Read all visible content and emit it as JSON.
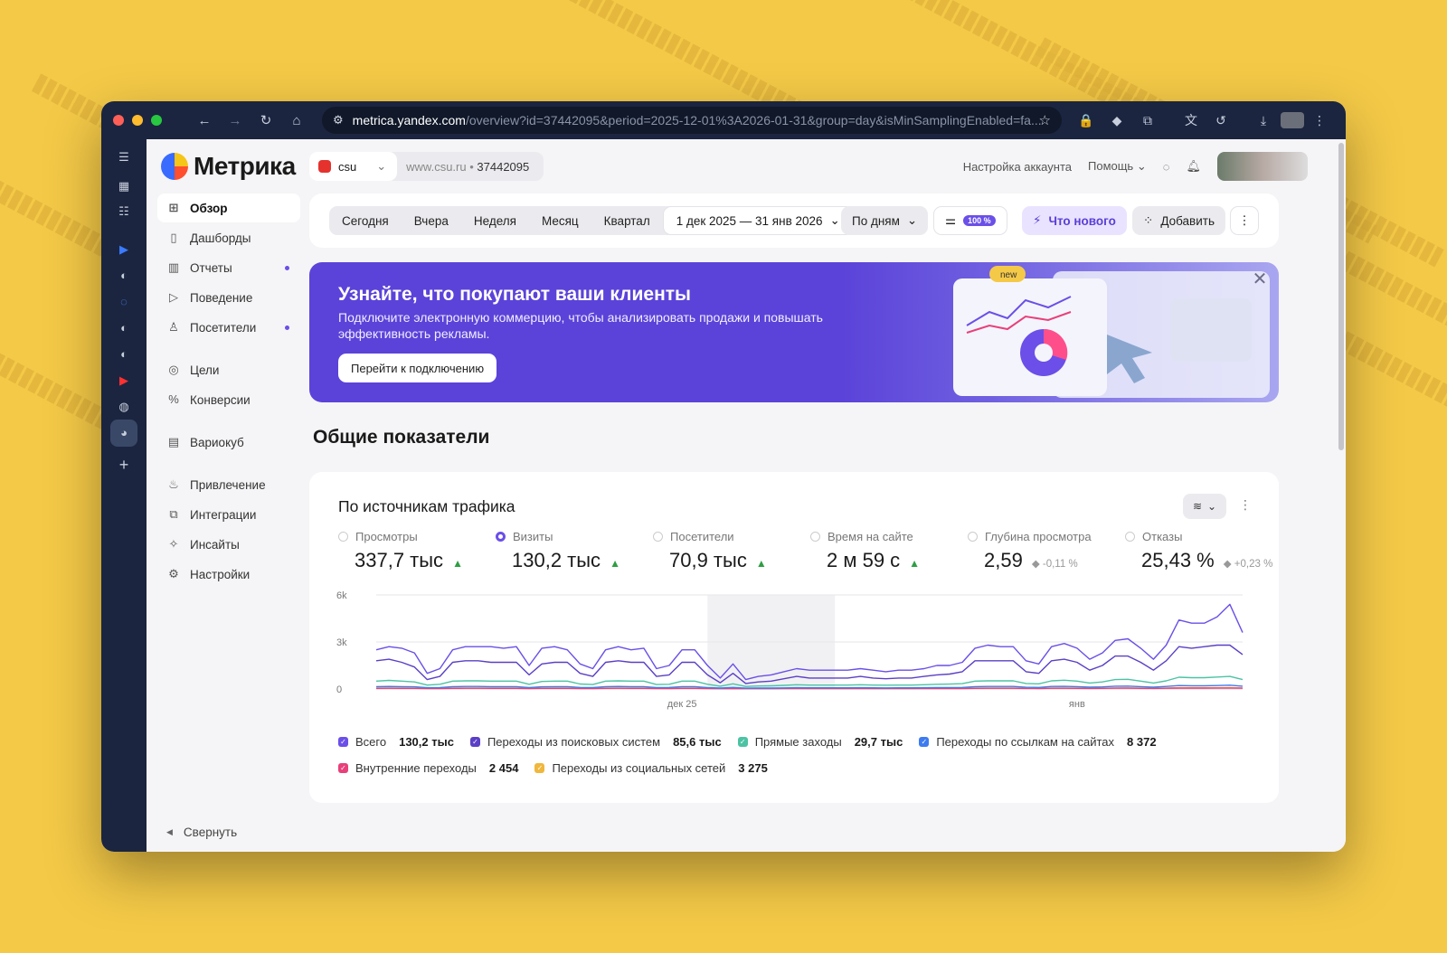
{
  "browser": {
    "url_domain": "metrica.yandex.com",
    "url_path": "/overview?id=37442095&period=2025-12-01%3A2026-01-31&group=day&isMinSamplingEnabled=fa..."
  },
  "app": {
    "logo_text": "Метрика",
    "site_counter": "csu",
    "site_url": "www.csu.ru",
    "site_id": "37442095",
    "account_settings": "Настройка аккаунта",
    "help": "Помощь"
  },
  "sidebar": {
    "items": [
      {
        "label": "Обзор",
        "icon": "grid-icon",
        "active": true
      },
      {
        "label": "Дашборды",
        "icon": "dashboard-icon"
      },
      {
        "label": "Отчеты",
        "icon": "bar-chart-icon",
        "dot": true
      },
      {
        "label": "Поведение",
        "icon": "play-icon"
      },
      {
        "label": "Посетители",
        "icon": "user-icon",
        "dot": true
      },
      {
        "label": "Цели",
        "icon": "target-icon"
      },
      {
        "label": "Конверсии",
        "icon": "percent-icon"
      },
      {
        "label": "Вариокуб",
        "icon": "list-icon"
      },
      {
        "label": "Привлечение",
        "icon": "fire-icon"
      },
      {
        "label": "Интеграции",
        "icon": "puzzle-icon"
      },
      {
        "label": "Инсайты",
        "icon": "sparkle-icon"
      },
      {
        "label": "Настройки",
        "icon": "gear-icon"
      }
    ],
    "collapse": "Свернуть"
  },
  "toolbar": {
    "periods": [
      "Сегодня",
      "Вчера",
      "Неделя",
      "Месяц",
      "Квартал"
    ],
    "date_range": "1 дек 2025 — 31 янв 2026",
    "grouping": "По дням",
    "sampling": "100 %",
    "whats_new": "Что нового",
    "add": "Добавить"
  },
  "banner": {
    "title": "Узнайте, что покупают ваши клиенты",
    "text": "Подключите электронную коммерцию, чтобы анализировать продажи и повышать эффективность рекламы.",
    "cta": "Перейти к подключению",
    "art_badge": "new"
  },
  "section_title": "Общие показатели",
  "card": {
    "title": "По источникам трафика",
    "metrics": [
      {
        "label": "Просмотры",
        "value": "337,7 тыс",
        "trend": "up",
        "selected": false
      },
      {
        "label": "Визиты",
        "value": "130,2 тыс",
        "trend": "up",
        "selected": true
      },
      {
        "label": "Посетители",
        "value": "70,9 тыс",
        "trend": "up",
        "selected": false
      },
      {
        "label": "Время на сайте",
        "value": "2 м 59 с",
        "trend": "up",
        "selected": false
      },
      {
        "label": "Глубина просмотра",
        "value": "2,59",
        "trend": "flat",
        "delta": "-0,11 %",
        "selected": false
      },
      {
        "label": "Отказы",
        "value": "25,43 %",
        "trend": "flat",
        "delta": "+0,23 %",
        "selected": false
      }
    ],
    "legend": [
      {
        "label": "Всего",
        "value": "130,2 тыс",
        "color": "#6b4fe8"
      },
      {
        "label": "Переходы из поисковых систем",
        "value": "85,6 тыс",
        "color": "#5b3fc6"
      },
      {
        "label": "Прямые заходы",
        "value": "29,7 тыс",
        "color": "#4cc3a3"
      },
      {
        "label": "Переходы по ссылкам на сайтах",
        "value": "8 372",
        "color": "#3d7bf0"
      },
      {
        "label": "Внутренние переходы",
        "value": "2 454",
        "color": "#e8407a"
      },
      {
        "label": "Переходы из социальных сетей",
        "value": "3 275",
        "color": "#f0b73d"
      }
    ]
  },
  "chart_data": {
    "type": "line",
    "x_tick_labels": [
      "дек 25",
      "янв"
    ],
    "y_tick_labels": [
      "0",
      "3k",
      "6k"
    ],
    "ylim": [
      0,
      6000
    ],
    "grid": true,
    "shaded_range": [
      26,
      36
    ],
    "series": [
      {
        "name": "Всего",
        "color": "#6b4fe8",
        "values": [
          2500,
          2700,
          2600,
          2300,
          1000,
          1300,
          2500,
          2700,
          2700,
          2700,
          2600,
          2700,
          1500,
          2600,
          2700,
          2500,
          1600,
          1300,
          2500,
          2700,
          2500,
          2600,
          1300,
          1500,
          2500,
          2500,
          1500,
          700,
          1600,
          600,
          800,
          900,
          1100,
          1300,
          1200,
          1200,
          1200,
          1200,
          1300,
          1200,
          1100,
          1200,
          1200,
          1300,
          1500,
          1500,
          1700,
          2600,
          2800,
          2700,
          2700,
          1800,
          1600,
          2700,
          2900,
          2600,
          1900,
          2300,
          3100,
          3200,
          2600,
          1900,
          2800,
          4400,
          4200,
          4200,
          4600,
          5400,
          3600
        ]
      },
      {
        "name": "Переходы из поисковых систем",
        "color": "#5b3fc6",
        "values": [
          1800,
          1900,
          1700,
          1400,
          600,
          800,
          1700,
          1800,
          1800,
          1700,
          1700,
          1700,
          900,
          1600,
          1700,
          1700,
          1000,
          800,
          1700,
          1800,
          1700,
          1700,
          800,
          900,
          1700,
          1700,
          900,
          400,
          1000,
          350,
          450,
          500,
          650,
          800,
          700,
          700,
          700,
          700,
          800,
          700,
          650,
          700,
          700,
          800,
          900,
          950,
          1100,
          1800,
          1800,
          1800,
          1800,
          1100,
          1000,
          1800,
          1900,
          1700,
          1200,
          1500,
          2100,
          2100,
          1700,
          1200,
          1800,
          2700,
          2600,
          2700,
          2800,
          2800,
          2200
        ]
      },
      {
        "name": "Прямые заходы",
        "color": "#4cc3a3",
        "values": [
          500,
          550,
          500,
          450,
          250,
          300,
          500,
          520,
          520,
          500,
          500,
          500,
          300,
          480,
          500,
          500,
          320,
          280,
          500,
          520,
          500,
          500,
          280,
          300,
          500,
          500,
          300,
          180,
          330,
          160,
          190,
          200,
          230,
          270,
          250,
          250,
          250,
          250,
          270,
          250,
          240,
          250,
          250,
          270,
          300,
          310,
          340,
          500,
          520,
          520,
          520,
          350,
          330,
          520,
          560,
          500,
          380,
          450,
          600,
          620,
          500,
          380,
          520,
          750,
          720,
          720,
          760,
          800,
          600
        ]
      },
      {
        "name": "Переходы по ссылкам на сайтах",
        "color": "#3d7bf0",
        "values": [
          150,
          160,
          150,
          140,
          80,
          90,
          150,
          160,
          160,
          150,
          150,
          150,
          90,
          140,
          150,
          150,
          100,
          90,
          150,
          160,
          150,
          150,
          90,
          100,
          150,
          150,
          90,
          60,
          100,
          50,
          60,
          60,
          70,
          80,
          75,
          75,
          75,
          75,
          80,
          75,
          70,
          75,
          75,
          80,
          90,
          95,
          100,
          150,
          160,
          160,
          160,
          110,
          100,
          160,
          170,
          150,
          115,
          135,
          180,
          185,
          150,
          115,
          160,
          220,
          210,
          210,
          220,
          240,
          180
        ]
      },
      {
        "name": "Внутренние переходы",
        "color": "#e8407a",
        "values": [
          40,
          45,
          40,
          38,
          25,
          28,
          40,
          45,
          45,
          40,
          40,
          40,
          28,
          38,
          40,
          40,
          30,
          27,
          40,
          45,
          40,
          40,
          27,
          28,
          40,
          40,
          28,
          20,
          30,
          18,
          20,
          20,
          22,
          25,
          24,
          24,
          24,
          24,
          25,
          24,
          23,
          24,
          24,
          25,
          28,
          29,
          30,
          40,
          45,
          45,
          45,
          32,
          30,
          45,
          48,
          42,
          34,
          38,
          50,
          52,
          42,
          34,
          45,
          60,
          58,
          58,
          62,
          66,
          50
        ]
      },
      {
        "name": "Переходы из социальных сетей",
        "color": "#f0b73d",
        "values": [
          55,
          60,
          55,
          50,
          30,
          35,
          55,
          58,
          58,
          55,
          55,
          55,
          35,
          52,
          55,
          55,
          38,
          33,
          55,
          58,
          55,
          55,
          33,
          35,
          55,
          55,
          35,
          22,
          38,
          20,
          23,
          24,
          28,
          32,
          30,
          30,
          30,
          30,
          32,
          30,
          29,
          30,
          30,
          32,
          36,
          37,
          40,
          55,
          58,
          58,
          58,
          42,
          40,
          58,
          62,
          55,
          44,
          50,
          66,
          68,
          55,
          44,
          58,
          80,
          78,
          78,
          82,
          88,
          66
        ]
      }
    ]
  }
}
